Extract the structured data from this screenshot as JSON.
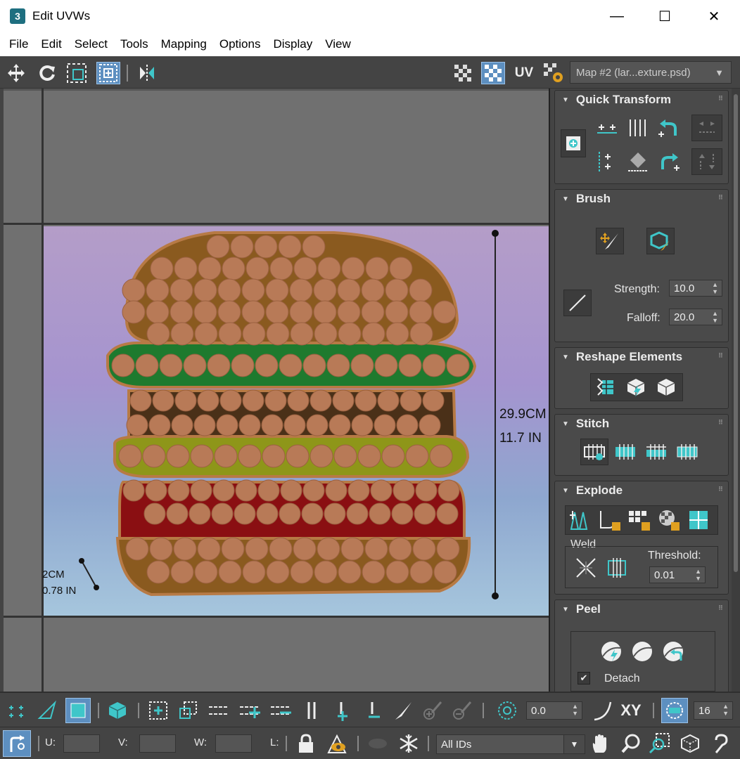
{
  "window": {
    "title": "Edit UVWs",
    "app_icon_text": "3",
    "minimize": "—",
    "maximize": "☐",
    "close": "✕"
  },
  "menu": [
    "File",
    "Edit",
    "Select",
    "Tools",
    "Mapping",
    "Options",
    "Display",
    "View"
  ],
  "toolbar": {
    "uv_label": "UV",
    "map_select": "Map #2 (lar...exture.psd)"
  },
  "viewport": {
    "height_measure_cm": "29.9CM",
    "height_measure_in": "11.7 IN",
    "small_measure_cm": "2CM",
    "small_measure_in": "0.78 IN"
  },
  "panels": {
    "quick_transform": {
      "title": "Quick Transform"
    },
    "brush": {
      "title": "Brush",
      "strength_label": "Strength:",
      "strength_value": "10.0",
      "falloff_label": "Falloff:",
      "falloff_value": "20.0"
    },
    "reshape": {
      "title": "Reshape Elements"
    },
    "stitch": {
      "title": "Stitch"
    },
    "explode": {
      "title": "Explode",
      "weld_label": "Weld",
      "threshold_label": "Threshold:",
      "threshold_value": "0.01"
    },
    "peel": {
      "title": "Peel",
      "detach_label": "Detach",
      "detach_checked": true
    }
  },
  "bottom": {
    "angle_value": "0.0",
    "xy_label": "XY",
    "grid_value": "16",
    "u_label": "U:",
    "v_label": "V:",
    "w_label": "W:",
    "l_label": "L:",
    "ids_select": "All IDs"
  },
  "colors": {
    "accent": "#3fc6c9",
    "active_button": "#5d8fc0",
    "bun": "#8b5a1e",
    "circle": "#b87a57"
  }
}
